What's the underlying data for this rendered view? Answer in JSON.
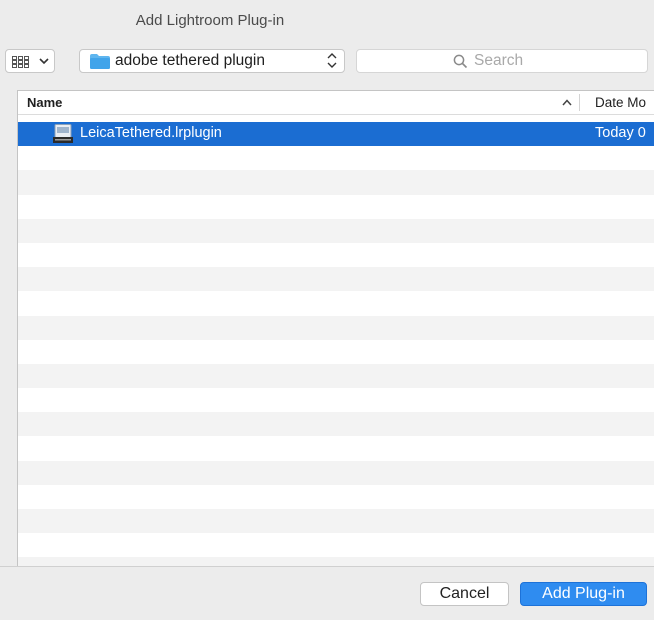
{
  "window": {
    "title": "Add Lightroom Plug-in"
  },
  "toolbar": {
    "view_button": {
      "icon": "icon-view-grid-icon",
      "menu_icon": "chevron-down-icon"
    },
    "location": {
      "icon": "folder-icon",
      "label": "adobe tethered plugin",
      "menu_icon": "up-down-arrows-icon"
    },
    "search": {
      "icon": "magnifying-glass-icon",
      "placeholder": "Search"
    }
  },
  "file_list": {
    "columns": {
      "name": "Name",
      "date": "Date Mo"
    },
    "sort_indicator": "^",
    "rows": [
      {
        "name": "LeicaTethered.lrplugin",
        "date": "Today 0",
        "icon": "plugin-file-icon",
        "selected": true
      }
    ]
  },
  "footer": {
    "cancel_label": "Cancel",
    "add_label": "Add Plug-in"
  },
  "colors": {
    "selection": "#1b6dd2",
    "primary_button": "#2f8cf0",
    "folder": "#5fb6ef"
  }
}
